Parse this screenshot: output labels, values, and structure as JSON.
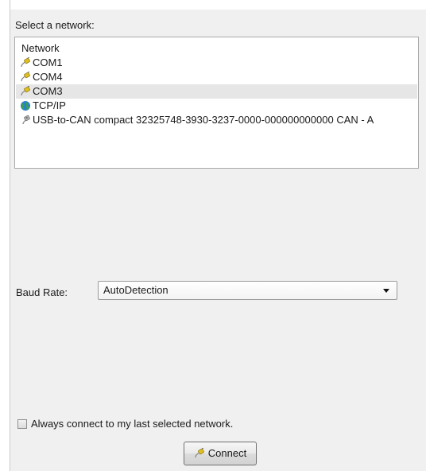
{
  "network_section": {
    "label": "Select a network:",
    "list_header": "Network",
    "items": [
      {
        "label": "COM1",
        "icon": "serial-plug-icon",
        "selected": false
      },
      {
        "label": "COM4",
        "icon": "serial-plug-icon",
        "selected": false
      },
      {
        "label": "COM3",
        "icon": "serial-plug-icon",
        "selected": true
      },
      {
        "label": "TCP/IP",
        "icon": "globe-network-icon",
        "selected": false
      },
      {
        "label": "USB-to-CAN compact 32325748-3930-3237-0000-000000000000 CAN - A",
        "icon": "usb-plug-icon",
        "selected": false
      }
    ]
  },
  "baud_rate": {
    "label": "Baud Rate:",
    "selected": "AutoDetection"
  },
  "remember": {
    "label": "Always connect to my last selected network.",
    "checked": false
  },
  "connect_button": {
    "label": "Connect",
    "icon": "serial-plug-icon"
  },
  "colors": {
    "panel_bg": "#f0f0f0",
    "list_bg": "#ffffff",
    "selected_row": "#e6e6e6",
    "plug_yellow": "#e0c020",
    "globe_blue": "#2a7fd0",
    "globe_green": "#3aa34a"
  }
}
